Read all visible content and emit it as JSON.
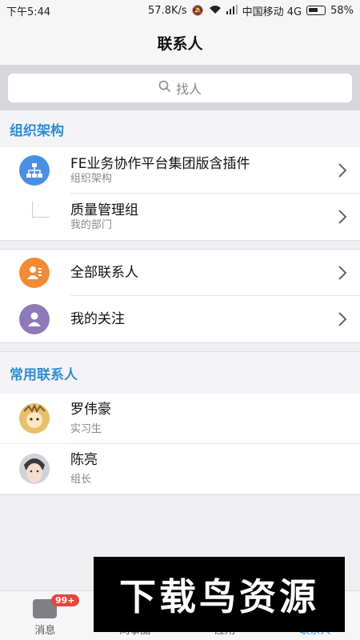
{
  "status_bar": {
    "time": "下午5:44",
    "speed": "57.8K/s",
    "carrier": "中国移动 4G",
    "battery": "58%",
    "battery_level": 0.58
  },
  "header": {
    "title": "联系人"
  },
  "search": {
    "placeholder": "找人"
  },
  "org_section": {
    "title": "组织架构",
    "items": [
      {
        "name": "FE业务协作平台集团版含插件",
        "sub": "组织架构"
      },
      {
        "name": "质量管理组",
        "sub": "我的部门"
      }
    ]
  },
  "shortcuts": {
    "items": [
      {
        "name": "全部联系人"
      },
      {
        "name": "我的关注"
      }
    ]
  },
  "frequent_section": {
    "title": "常用联系人",
    "items": [
      {
        "name": "罗伟豪",
        "sub": "实习生"
      },
      {
        "name": "陈亮",
        "sub": "组长"
      }
    ]
  },
  "tabs": [
    {
      "label": "消息",
      "badge": "99+"
    },
    {
      "label": "同事圈"
    },
    {
      "label": "应用"
    },
    {
      "label": "联系人",
      "active": true
    }
  ],
  "watermark": {
    "text": "下载鸟资源"
  },
  "colors": {
    "accent": "#2f8dd3",
    "org_icon": "#4a8fe6",
    "all_contacts_icon": "#f58a35",
    "follow_icon": "#8e7ab8",
    "badge": "#e9443a"
  }
}
